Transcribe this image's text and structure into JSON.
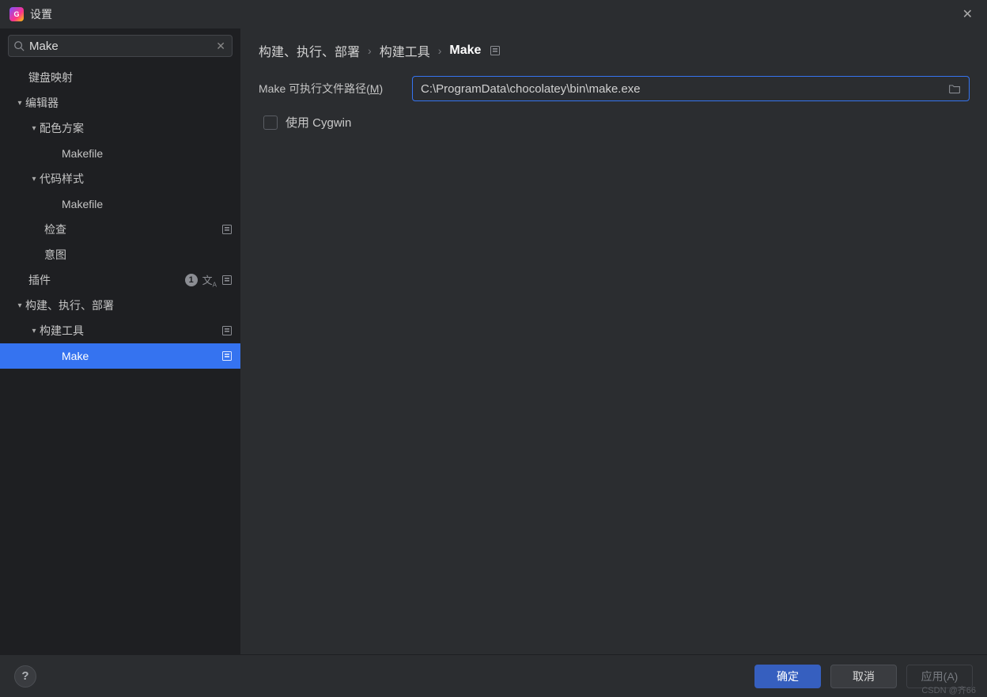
{
  "window": {
    "title": "设置"
  },
  "sidebar": {
    "search": {
      "value": "Make"
    },
    "items": {
      "keymap": "键盘映射",
      "editor": "编辑器",
      "colorScheme": "配色方案",
      "colorScheme_makefile": "Makefile",
      "codeStyle": "代码样式",
      "codeStyle_makefile": "Makefile",
      "inspections": "检查",
      "intentions": "意图",
      "plugins": "插件",
      "build": "构建、执行、部署",
      "buildTools": "构建工具",
      "make": "Make"
    },
    "plugins_badge": "1"
  },
  "breadcrumb": {
    "seg1": "构建、执行、部署",
    "seg2": "构建工具",
    "seg3": "Make"
  },
  "form": {
    "pathLabel_pre": "Make 可执行文件路径(",
    "pathLabel_key": "M",
    "pathLabel_post": ")",
    "pathValue": "C:\\ProgramData\\chocolatey\\bin\\make.exe",
    "useCygwin": "使用 Cygwin"
  },
  "footer": {
    "ok": "确定",
    "cancel": "取消",
    "apply": "应用(A)"
  },
  "watermark": "CSDN @齐66"
}
